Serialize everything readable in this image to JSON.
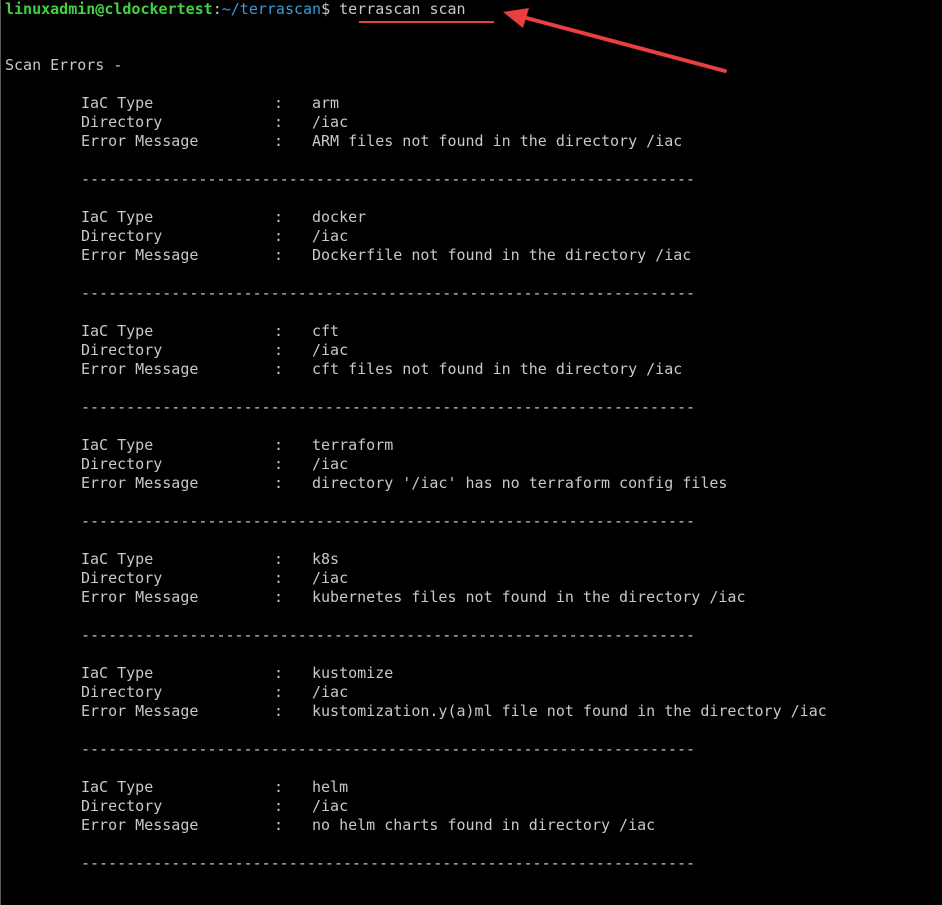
{
  "prompt": {
    "user_host": "linuxadmin@cldockertest",
    "separator": ":",
    "path": "~/terrascan",
    "symbol": "$ ",
    "command": "terrascan scan"
  },
  "header": "Scan Errors -",
  "labels": {
    "iac_type": "IaC Type",
    "directory": "Directory",
    "error_message": "Error Message",
    "colon": ":"
  },
  "separator_line": "--------------------------------------------------------------------",
  "errors": [
    {
      "iac_type": "arm",
      "directory": "/iac",
      "error_message": "ARM files not found in the directory /iac"
    },
    {
      "iac_type": "docker",
      "directory": "/iac",
      "error_message": "Dockerfile not found in the directory /iac"
    },
    {
      "iac_type": "cft",
      "directory": "/iac",
      "error_message": "cft files not found in the directory /iac"
    },
    {
      "iac_type": "terraform",
      "directory": "/iac",
      "error_message": "directory '/iac' has no terraform config files"
    },
    {
      "iac_type": "k8s",
      "directory": "/iac",
      "error_message": "kubernetes files not found in the directory /iac"
    },
    {
      "iac_type": "kustomize",
      "directory": "/iac",
      "error_message": "kustomization.y(a)ml file not found in the directory /iac"
    },
    {
      "iac_type": "helm",
      "directory": "/iac",
      "error_message": "no helm charts found in directory /iac"
    }
  ],
  "colors": {
    "background": "#000000",
    "text": "#c8c8c8",
    "prompt_user": "#3fd43f",
    "prompt_path": "#3a9cd6",
    "annotation": "#e8403f"
  },
  "annotation": {
    "arrow_icon": "red-arrow-icon"
  }
}
